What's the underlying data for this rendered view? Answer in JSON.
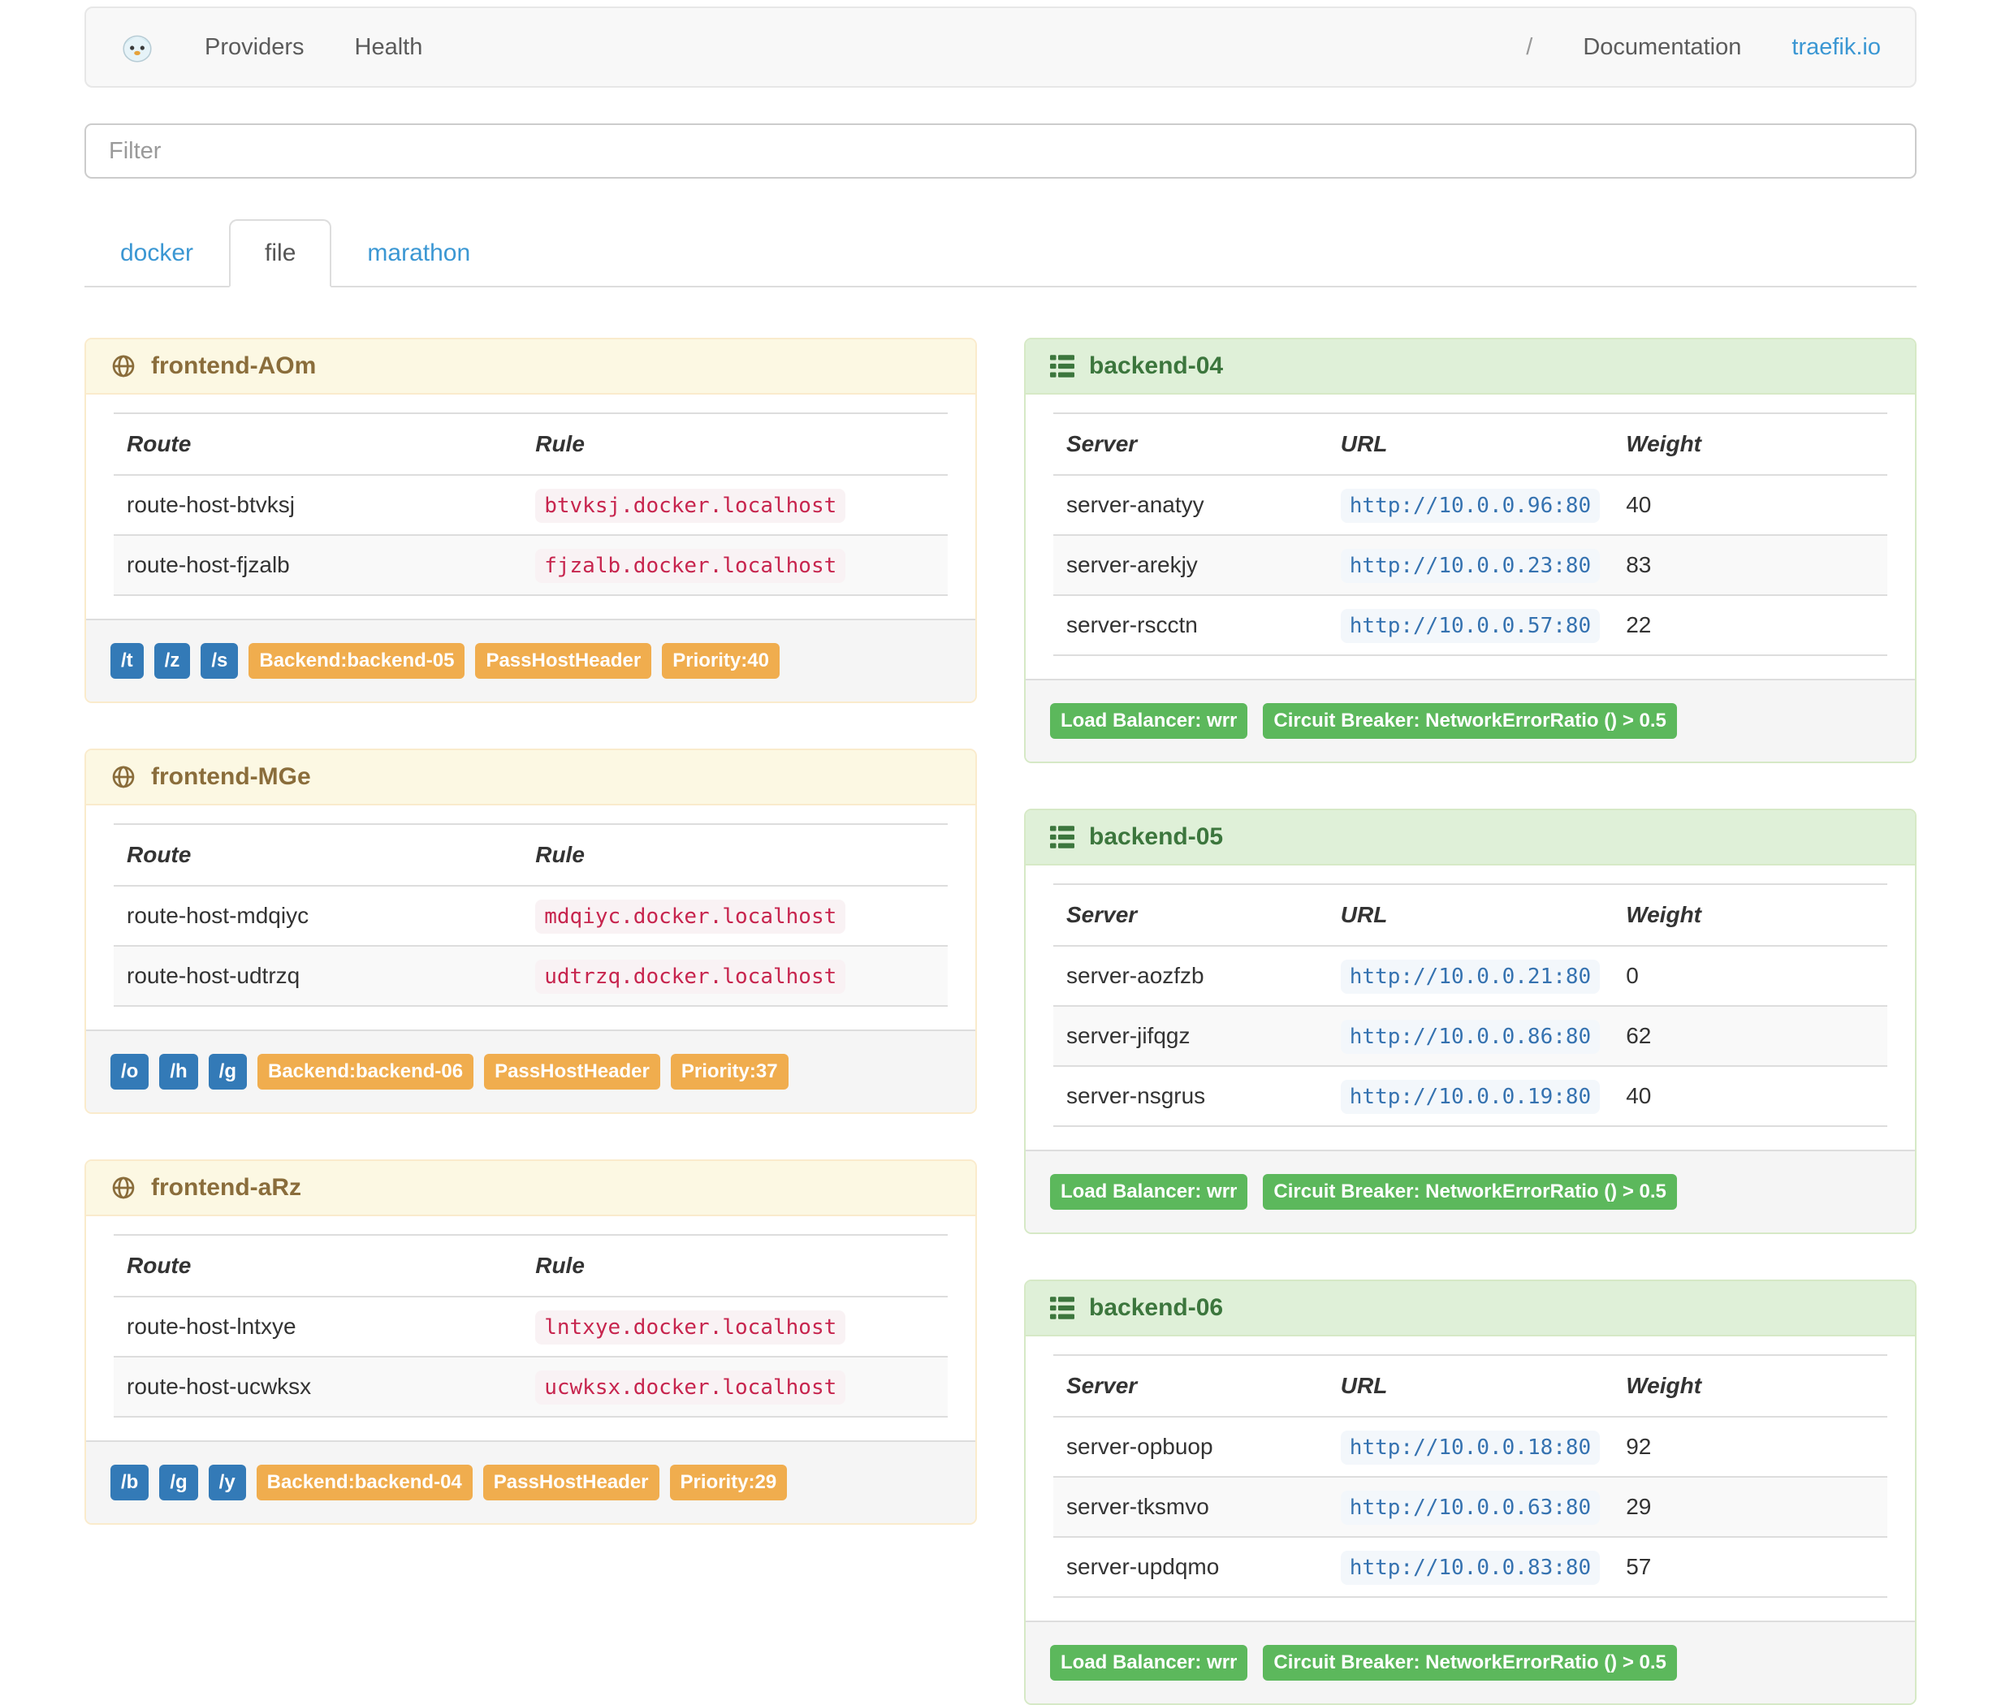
{
  "navbar": {
    "providers": "Providers",
    "health": "Health",
    "separator": "/",
    "documentation": "Documentation",
    "traefik_io": "traefik.io"
  },
  "filter": {
    "placeholder": "Filter"
  },
  "tabs": [
    {
      "label": "docker",
      "active": false
    },
    {
      "label": "file",
      "active": true
    },
    {
      "label": "marathon",
      "active": false
    }
  ],
  "colors": {
    "link_blue": "#3b97d3",
    "frontend_header_bg": "#fcf8e3",
    "frontend_text": "#8a6d3b",
    "backend_header_bg": "#dff0d8",
    "backend_text": "#3c763d",
    "badge_blue": "#337ab7",
    "badge_orange": "#f0ad4e",
    "badge_green": "#5cb85c",
    "rule_red": "#c7254e",
    "url_blue": "#3572b0"
  },
  "frontends": [
    {
      "title": "frontend-AOm",
      "columns": [
        "Route",
        "Rule"
      ],
      "rows": [
        {
          "route": "route-host-btvksj",
          "rule": "btvksj.docker.localhost"
        },
        {
          "route": "route-host-fjzalb",
          "rule": "fjzalb.docker.localhost"
        }
      ],
      "entry_badges": [
        "/t",
        "/z",
        "/s"
      ],
      "detail_badges": [
        "Backend:backend-05",
        "PassHostHeader",
        "Priority:40"
      ]
    },
    {
      "title": "frontend-MGe",
      "columns": [
        "Route",
        "Rule"
      ],
      "rows": [
        {
          "route": "route-host-mdqiyc",
          "rule": "mdqiyc.docker.localhost"
        },
        {
          "route": "route-host-udtrzq",
          "rule": "udtrzq.docker.localhost"
        }
      ],
      "entry_badges": [
        "/o",
        "/h",
        "/g"
      ],
      "detail_badges": [
        "Backend:backend-06",
        "PassHostHeader",
        "Priority:37"
      ]
    },
    {
      "title": "frontend-aRz",
      "columns": [
        "Route",
        "Rule"
      ],
      "rows": [
        {
          "route": "route-host-lntxye",
          "rule": "lntxye.docker.localhost"
        },
        {
          "route": "route-host-ucwksx",
          "rule": "ucwksx.docker.localhost"
        }
      ],
      "entry_badges": [
        "/b",
        "/g",
        "/y"
      ],
      "detail_badges": [
        "Backend:backend-04",
        "PassHostHeader",
        "Priority:29"
      ]
    }
  ],
  "backends": [
    {
      "title": "backend-04",
      "columns": [
        "Server",
        "URL",
        "Weight"
      ],
      "rows": [
        {
          "server": "server-anatyy",
          "url": "http://10.0.0.96:80",
          "weight": "40"
        },
        {
          "server": "server-arekjy",
          "url": "http://10.0.0.23:80",
          "weight": "83"
        },
        {
          "server": "server-rscctn",
          "url": "http://10.0.0.57:80",
          "weight": "22"
        }
      ],
      "badges": [
        "Load Balancer: wrr",
        "Circuit Breaker: NetworkErrorRatio () > 0.5"
      ]
    },
    {
      "title": "backend-05",
      "columns": [
        "Server",
        "URL",
        "Weight"
      ],
      "rows": [
        {
          "server": "server-aozfzb",
          "url": "http://10.0.0.21:80",
          "weight": "0"
        },
        {
          "server": "server-jifqgz",
          "url": "http://10.0.0.86:80",
          "weight": "62"
        },
        {
          "server": "server-nsgrus",
          "url": "http://10.0.0.19:80",
          "weight": "40"
        }
      ],
      "badges": [
        "Load Balancer: wrr",
        "Circuit Breaker: NetworkErrorRatio () > 0.5"
      ]
    },
    {
      "title": "backend-06",
      "columns": [
        "Server",
        "URL",
        "Weight"
      ],
      "rows": [
        {
          "server": "server-opbuop",
          "url": "http://10.0.0.18:80",
          "weight": "92"
        },
        {
          "server": "server-tksmvo",
          "url": "http://10.0.0.63:80",
          "weight": "29"
        },
        {
          "server": "server-updqmo",
          "url": "http://10.0.0.83:80",
          "weight": "57"
        }
      ],
      "badges": [
        "Load Balancer: wrr",
        "Circuit Breaker: NetworkErrorRatio () > 0.5"
      ]
    }
  ]
}
